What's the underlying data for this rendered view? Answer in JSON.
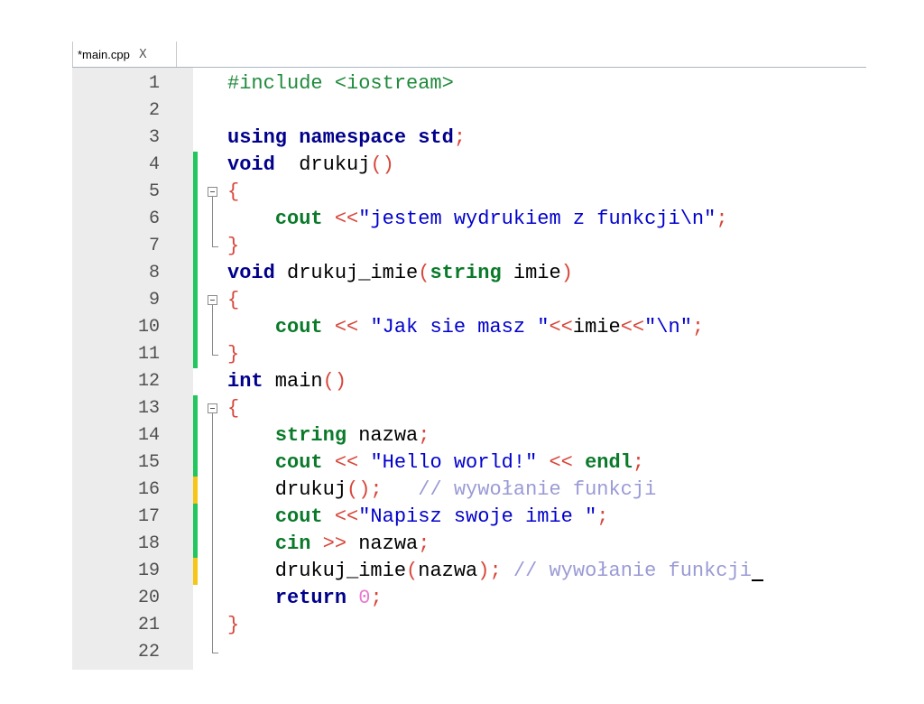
{
  "tab": {
    "label": "*main.cpp",
    "close": "X"
  },
  "colors": {
    "changed_saved": "#22c55e",
    "changed_unsaved": "#f5c518",
    "gutter_bg": "#ececec"
  },
  "lines": [
    {
      "n": "1",
      "mark": "",
      "code": [
        [
          "pp",
          "#include <iostream>"
        ]
      ]
    },
    {
      "n": "2",
      "mark": "",
      "code": []
    },
    {
      "n": "3",
      "mark": "",
      "code": [
        [
          "kw",
          "using namespace std"
        ],
        [
          "op",
          ";"
        ]
      ]
    },
    {
      "n": "4",
      "mark": "green",
      "code": [
        [
          "kw",
          "void"
        ],
        [
          "",
          "  drukuj"
        ],
        [
          "op",
          "()"
        ]
      ]
    },
    {
      "n": "5",
      "mark": "green",
      "code": [
        [
          "op",
          "{"
        ]
      ]
    },
    {
      "n": "6",
      "mark": "green",
      "code": [
        [
          "",
          "    "
        ],
        [
          "ty",
          "cout"
        ],
        [
          "",
          " "
        ],
        [
          "op",
          "<<"
        ],
        [
          "str",
          "\"jestem wydrukiem z funkcji\\n\""
        ],
        [
          "op",
          ";"
        ]
      ]
    },
    {
      "n": "7",
      "mark": "green",
      "code": [
        [
          "op",
          "}"
        ]
      ]
    },
    {
      "n": "8",
      "mark": "green",
      "code": [
        [
          "kw",
          "void"
        ],
        [
          "",
          " drukuj_imie"
        ],
        [
          "op",
          "("
        ],
        [
          "ty",
          "string"
        ],
        [
          "",
          " imie"
        ],
        [
          "op",
          ")"
        ]
      ]
    },
    {
      "n": "9",
      "mark": "green",
      "code": [
        [
          "op",
          "{"
        ]
      ]
    },
    {
      "n": "10",
      "mark": "green",
      "code": [
        [
          "",
          "    "
        ],
        [
          "ty",
          "cout"
        ],
        [
          "",
          " "
        ],
        [
          "op",
          "<<"
        ],
        [
          "",
          " "
        ],
        [
          "str",
          "\"Jak sie masz \""
        ],
        [
          "op",
          "<<"
        ],
        [
          "",
          "imie"
        ],
        [
          "op",
          "<<"
        ],
        [
          "str",
          "\"\\n\""
        ],
        [
          "op",
          ";"
        ]
      ]
    },
    {
      "n": "11",
      "mark": "green",
      "code": [
        [
          "op",
          "}"
        ]
      ]
    },
    {
      "n": "12",
      "mark": "",
      "code": [
        [
          "kw",
          "int"
        ],
        [
          "",
          " main"
        ],
        [
          "op",
          "()"
        ]
      ]
    },
    {
      "n": "13",
      "mark": "green",
      "code": [
        [
          "op",
          "{"
        ]
      ]
    },
    {
      "n": "14",
      "mark": "green",
      "code": [
        [
          "",
          "    "
        ],
        [
          "ty",
          "string"
        ],
        [
          "",
          " nazwa"
        ],
        [
          "op",
          ";"
        ]
      ]
    },
    {
      "n": "15",
      "mark": "green",
      "code": [
        [
          "",
          "    "
        ],
        [
          "ty",
          "cout"
        ],
        [
          "",
          " "
        ],
        [
          "op",
          "<<"
        ],
        [
          "",
          " "
        ],
        [
          "str",
          "\"Hello world!\""
        ],
        [
          "",
          " "
        ],
        [
          "op",
          "<<"
        ],
        [
          "",
          " "
        ],
        [
          "ty",
          "endl"
        ],
        [
          "op",
          ";"
        ]
      ]
    },
    {
      "n": "16",
      "mark": "yellow",
      "code": [
        [
          "",
          "    drukuj"
        ],
        [
          "op",
          "();"
        ],
        [
          "",
          "   "
        ],
        [
          "cm",
          "// wywołanie funkcji"
        ]
      ]
    },
    {
      "n": "17",
      "mark": "green",
      "code": [
        [
          "",
          "    "
        ],
        [
          "ty",
          "cout"
        ],
        [
          "",
          " "
        ],
        [
          "op",
          "<<"
        ],
        [
          "str",
          "\"Napisz swoje imie \""
        ],
        [
          "op",
          ";"
        ]
      ]
    },
    {
      "n": "18",
      "mark": "green",
      "code": [
        [
          "",
          "    "
        ],
        [
          "ty",
          "cin"
        ],
        [
          "",
          " "
        ],
        [
          "op",
          ">>"
        ],
        [
          "",
          " nazwa"
        ],
        [
          "op",
          ";"
        ]
      ]
    },
    {
      "n": "19",
      "mark": "yellow",
      "code": [
        [
          "",
          "    drukuj_imie"
        ],
        [
          "op",
          "("
        ],
        [
          "",
          "nazwa"
        ],
        [
          "op",
          ");"
        ],
        [
          "",
          " "
        ],
        [
          "cm",
          "// wywołanie funkcji"
        ],
        [
          "cursor",
          ""
        ]
      ]
    },
    {
      "n": "20",
      "mark": "",
      "code": [
        [
          "",
          "    "
        ],
        [
          "kw",
          "return"
        ],
        [
          "",
          " "
        ],
        [
          "num",
          "0"
        ],
        [
          "op",
          ";"
        ]
      ]
    },
    {
      "n": "21",
      "mark": "",
      "code": [
        [
          "op",
          "}"
        ]
      ]
    },
    {
      "n": "22",
      "mark": "",
      "code": []
    }
  ]
}
